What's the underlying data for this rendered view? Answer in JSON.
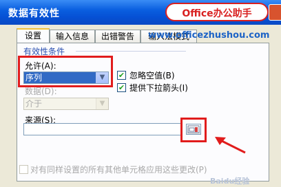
{
  "window": {
    "title": "数据有效性"
  },
  "brand": {
    "text": "Office办公助手",
    "url": "www.officezhushou.com"
  },
  "tabs": [
    {
      "label": "设置"
    },
    {
      "label": "输入信息"
    },
    {
      "label": "出错警告"
    },
    {
      "label": "输入法模式"
    }
  ],
  "settings": {
    "group_title": "有效性条件",
    "allow_label": "允许(A):",
    "allow_value": "序列",
    "ignore_blank_label": "忽略空值(B)",
    "dropdown_label": "提供下拉箭头(I)",
    "data_label": "数据(D):",
    "data_value": "介于",
    "source_label": "来源(S):",
    "source_value": "",
    "apply_all_label": "对有同样设置的所有其他单元格应用这些更改(P)"
  },
  "watermark": "Baidu经验"
}
